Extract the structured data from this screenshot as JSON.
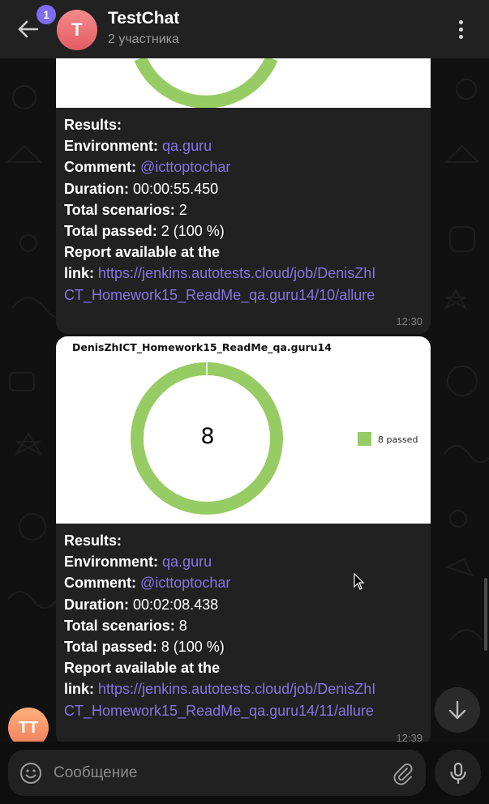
{
  "header": {
    "back_icon": "arrow-left-icon",
    "unread_count": "1",
    "avatar_letter": "T",
    "title": "TestChat",
    "subtitle": "2 участника",
    "menu_icon": "more-vertical-icon"
  },
  "messages": [
    {
      "results_label": "Results:",
      "environment_label": "Environment:",
      "environment_value": "qa.guru",
      "comment_label": "Comment:",
      "comment_value": "@icttoptochar",
      "duration_label": "Duration:",
      "duration_value": "00:00:55.450",
      "scenarios_label": "Total scenarios:",
      "scenarios_value": "2",
      "passed_label": "Total passed:",
      "passed_value": "2 (100 %)",
      "report_label_1": "Report available at the",
      "report_label_2": "link:",
      "link_line_1": "https://jenkins.autotests.cloud/job/DenisZhI",
      "link_line_2": "CT_Homework15_ReadMe_qa.guru14/10/allure",
      "time": "12:30"
    },
    {
      "report_title": "DenisZhICT_Homework15_ReadMe_qa.guru14",
      "results_label": "Results:",
      "environment_label": "Environment:",
      "environment_value": "qa.guru",
      "comment_label": "Comment:",
      "comment_value": "@icttoptochar",
      "duration_label": "Duration:",
      "duration_value": "00:02:08.438",
      "scenarios_label": "Total scenarios:",
      "scenarios_value": "8",
      "passed_label": "Total passed:",
      "passed_value": "8 (100 %)",
      "report_label_1": "Report available at the",
      "report_label_2": "link:",
      "link_line_1": "https://jenkins.autotests.cloud/job/DenisZhI",
      "link_line_2": "CT_Homework15_ReadMe_qa.guru14/11/allure",
      "time": "12:39"
    }
  ],
  "chart_data": {
    "type": "pie",
    "title": "DenisZhICT_Homework15_ReadMe_qa.guru14",
    "center_label": "8",
    "slices": [
      {
        "name": "passed",
        "value": 8,
        "color": "#97cc64"
      }
    ],
    "legend": [
      "8 passed"
    ],
    "legend_position": "right"
  },
  "sender": {
    "avatar_initials": "TT"
  },
  "composer": {
    "placeholder": "Сообщение",
    "emoji_icon": "smile-icon",
    "attach_icon": "paperclip-icon",
    "voice_icon": "microphone-icon"
  },
  "scroll_down_icon": "arrow-down-icon",
  "colors": {
    "accent": "#8774e1",
    "badge": "#7d6bf0",
    "passed": "#97cc64",
    "bubble": "#212121"
  }
}
